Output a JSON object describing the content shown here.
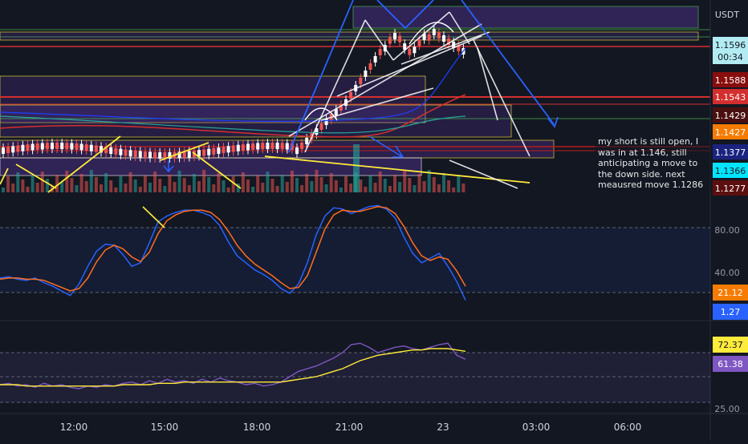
{
  "chart_data": [
    {
      "type": "line",
      "description_kind": "price",
      "currency": "USDT",
      "x_ticks": [
        "12:00",
        "15:00",
        "18:00",
        "21:00",
        "23",
        "03:00",
        "06:00"
      ],
      "price_labels": [
        {
          "value": "1.1596",
          "sub": "00:34",
          "color": "#b2ebf2",
          "text_color": "#131722"
        },
        {
          "value": "1.1588",
          "color": "#880e0e",
          "text_color": "#ffffff"
        },
        {
          "value": "1.1543",
          "color": "#d32f2f",
          "text_color": "#ffffff"
        },
        {
          "value": "1.1429",
          "color": "#4a1010",
          "text_color": "#ffffff"
        },
        {
          "value": "1.1427",
          "color": "#f57c00",
          "text_color": "#ffffff"
        },
        {
          "value": "1.1377",
          "color": "#1a237e",
          "text_color": "#ffffff"
        },
        {
          "value": "1.1366",
          "color": "#00e5ff",
          "text_color": "#131722"
        },
        {
          "value": "1.1277",
          "color": "#5c0f0f",
          "text_color": "#ffffff"
        }
      ],
      "note": "my short is still open, I was in at 1.146, still anticipating a move to the down side. next meausred move 1.1286"
    },
    {
      "type": "line",
      "description_kind": "stochastic",
      "levels": [
        "80.00",
        "40.00"
      ],
      "y_range": [
        0,
        100
      ],
      "series": [
        {
          "color": "#2962ff",
          "values": [
            35,
            36,
            34,
            33,
            35,
            31,
            28,
            24,
            20,
            30,
            45,
            58,
            64,
            63,
            55,
            45,
            48,
            65,
            83,
            88,
            91,
            93,
            93,
            91,
            88,
            80,
            66,
            54,
            48,
            42,
            38,
            33,
            26,
            22,
            30,
            48,
            72,
            88,
            95,
            94,
            90,
            93,
            96,
            97,
            94,
            86,
            70,
            56,
            48,
            52,
            56,
            45,
            32,
            16
          ]
        },
        {
          "color": "#ff6d1f",
          "values": [
            34,
            35,
            35,
            34,
            34,
            33,
            30,
            27,
            24,
            26,
            35,
            49,
            59,
            63,
            60,
            53,
            49,
            57,
            73,
            84,
            89,
            92,
            93,
            93,
            91,
            85,
            75,
            63,
            54,
            47,
            42,
            37,
            31,
            26,
            27,
            37,
            57,
            77,
            89,
            93,
            92,
            92,
            94,
            96,
            95,
            90,
            79,
            65,
            54,
            50,
            53,
            51,
            41,
            28
          ]
        }
      ],
      "last_values": [
        {
          "value": "21.12",
          "color": "#f57c00"
        },
        {
          "value": "1.27",
          "color": "#2962ff"
        }
      ]
    },
    {
      "type": "line",
      "description_kind": "rsi",
      "levels": [
        "25.00"
      ],
      "y_range": [
        20,
        80
      ],
      "series": [
        {
          "color": "#7e57c2",
          "values": [
            38,
            39,
            37,
            38,
            36,
            39,
            37,
            38,
            36,
            35,
            37,
            36,
            38,
            37,
            39,
            40,
            38,
            41,
            39,
            42,
            40,
            41,
            39,
            42,
            40,
            43,
            41,
            40,
            38,
            39,
            37,
            38,
            40,
            44,
            48,
            50,
            52,
            55,
            58,
            62,
            68,
            69,
            66,
            62,
            64,
            66,
            67,
            65,
            64,
            66,
            68,
            69,
            60,
            57
          ]
        },
        {
          "color": "#ffeb3b",
          "values": [
            38,
            38,
            38,
            37,
            37,
            37,
            37,
            37,
            37,
            37,
            37,
            37,
            37,
            37,
            38,
            38,
            38,
            38,
            39,
            39,
            39,
            40,
            40,
            40,
            40,
            40,
            40,
            40,
            40,
            40,
            40,
            40,
            40,
            41,
            42,
            43,
            44,
            46,
            48,
            50,
            53,
            56,
            58,
            60,
            61,
            62,
            63,
            64,
            64,
            65,
            65,
            65,
            64,
            63
          ]
        }
      ],
      "last_values": [
        {
          "value": "72.37",
          "color": "#ffeb3b"
        },
        {
          "value": "61.38",
          "color": "#7e57c2"
        }
      ]
    }
  ]
}
